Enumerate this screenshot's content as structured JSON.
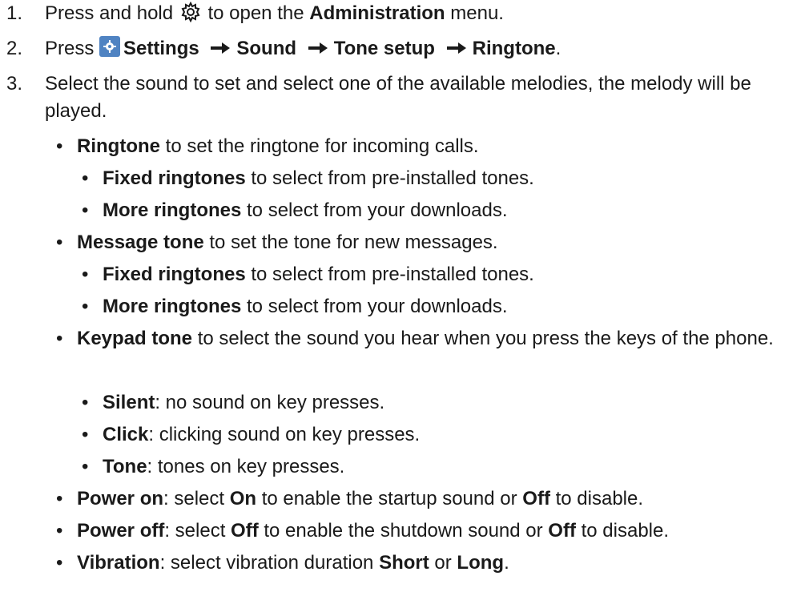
{
  "steps": [
    {
      "num": "1.",
      "parts": [
        "Press and hold",
        "to open the",
        "Administration",
        "menu."
      ]
    },
    {
      "num": "2.",
      "parts": [
        "Press",
        "Settings",
        "Sound",
        "Tone setup",
        "Ringtone",
        "."
      ]
    },
    {
      "num": "3.",
      "text": "Select the sound to set and select one of the available melodies, the melody will be played."
    }
  ],
  "items": [
    {
      "level": 1,
      "term": "Ringtone",
      "desc": " to set the ringtone for incoming calls."
    },
    {
      "level": 2,
      "term": "Fixed ringtones",
      "desc": " to select from pre-installed tones."
    },
    {
      "level": 2,
      "term": "More ringtones",
      "desc": " to select from your downloads."
    },
    {
      "level": 1,
      "term": "Message tone",
      "desc": " to set the tone for new messages."
    },
    {
      "level": 2,
      "term": "Fixed ringtones",
      "desc": " to select from pre-installed tones."
    },
    {
      "level": 2,
      "term": "More ringtones",
      "desc": " to select from your downloads."
    },
    {
      "level": 1,
      "term": "Keypad tone",
      "desc": " to select the sound you hear when you press the keys of the phone."
    },
    {
      "level": 2,
      "term": "Silent",
      "desc": ": no sound on key presses."
    },
    {
      "level": 2,
      "term": "Click",
      "desc": ": clicking sound on key presses."
    },
    {
      "level": 2,
      "term": "Tone",
      "desc": ": tones on key presses."
    },
    {
      "level": 1,
      "term": "Power on",
      "parts": [
        ": select ",
        "On",
        " to enable the startup sound or ",
        "Off",
        " to disable."
      ]
    },
    {
      "level": 1,
      "term": "Power off",
      "parts": [
        ": select ",
        "Off",
        " to enable the shutdown sound or ",
        "Off",
        " to disable."
      ]
    },
    {
      "level": 1,
      "term": "Vibration",
      "parts": [
        ": select vibration duration ",
        "Short",
        " or ",
        "Long",
        "."
      ]
    }
  ],
  "bullet_glyph": "•",
  "icons": {
    "gear": "gear-icon",
    "settings": "settings-app-icon",
    "arrow": "right-arrow-icon"
  },
  "colors": {
    "text": "#1a1a1a",
    "settings_icon_bg": "#4f83c2"
  }
}
